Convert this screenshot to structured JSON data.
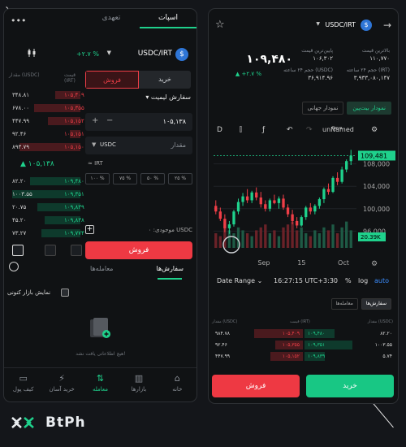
{
  "left": {
    "tabs": [
      "تعهدی",
      "اسپات"
    ],
    "active_tab": "اسپات",
    "pair": "USDC/IRT",
    "coin_glyph": "$",
    "change": "+۲.۷ %",
    "orderbook_headers": {
      "price": "قیمت (IRT)",
      "amount": "مقدار (USDC)"
    },
    "asks": [
      {
        "price": "۱۰۵,۴۰۹",
        "amount": "۳۴۸.۸۱",
        "depth": 0.35
      },
      {
        "price": "۱۰۵,۳۵۵",
        "amount": "۶۷۸.۰۰",
        "depth": 0.65
      },
      {
        "price": "۱۰۵,۱۵۲",
        "amount": "۴۴۷.۹۹",
        "depth": 0.45
      },
      {
        "price": "۱۰۵,۱۵۱",
        "amount": "۹۲.۴۶",
        "depth": 0.15
      },
      {
        "price": "۱۰۵,۱۵۰",
        "amount": "۸۹۳.۷۹",
        "depth": 0.85
      }
    ],
    "mid_price": "۱۰۵,۱۳۸",
    "bids": [
      {
        "price": "۱۰۹,۴۸۰",
        "amount": "۸۲.۲۰",
        "depth": 0.7
      },
      {
        "price": "۱۰۹,۳۵۱",
        "amount": "۱۰۰۳.۵۵",
        "depth": 0.95
      },
      {
        "price": "۱۰۹,۸۳۹",
        "amount": "۲۰.۷۵",
        "depth": 0.6
      },
      {
        "price": "۱۰۹,۸۳۸",
        "amount": "۴۵.۲۰",
        "depth": 0.5
      },
      {
        "price": "۱۰۹,۷۷۴",
        "amount": "۷۳.۲۷",
        "depth": 0.55
      }
    ],
    "buy_label": "خرید",
    "sell_label": "فروش",
    "order_type": "سفارش لیمیت",
    "price_value": "۱۰۵,۱۳۸",
    "amount_placeholder": "مقدار",
    "amount_unit": "USDC",
    "irt_label": "IRT",
    "percents": [
      "۱۰۰ %",
      "۷۵ %",
      "۵۰ %",
      "۲۵ %"
    ],
    "balance_text": "موجودی: ۰ USDC",
    "sell_button": "فروش",
    "orders_tab": "سفارش‌ها",
    "trades_tab": "معامله‌ها",
    "show_market": "نمایش بازار کنونی",
    "empty_text": "هیچ اطلاعاتی یافت نشد!",
    "nav": [
      {
        "label": "خانه",
        "icon": "⌂"
      },
      {
        "label": "بازارها",
        "icon": "▥"
      },
      {
        "label": "معامله",
        "icon": "⇅"
      },
      {
        "label": "خرید آسان",
        "icon": "⚡"
      },
      {
        "label": "کیف پول",
        "icon": "▭"
      }
    ]
  },
  "right": {
    "pair": "USDC/IRT",
    "coin_glyph": "$",
    "price": "۱۰۹,۴۸۰",
    "change": "+۲.۷ %",
    "stats": {
      "high_label": "بالاترین قیمت",
      "high": "۱۱۰,۷۷۰",
      "low_label": "پایین‌ترین قیمت",
      "low": "۱۰۶,۳۰۲",
      "vol_irt_label": "حجم ۲۴ ساعته (IRT)",
      "vol_irt": "۳,۹۳۳,۰۸۰,۱۴۷",
      "vol_usdc_label": "حجم ۲۴ ساعته (USDC)",
      "vol_usdc": "۳۶,۹۱۴.۹۶"
    },
    "chart_tabs": [
      "نمودار جهانی",
      "نمودار بیت‌پین"
    ],
    "active_chart_tab": "نمودار بیت‌پین",
    "toolbar": {
      "interval": "D",
      "title": "unNamed",
      "save": "Save"
    },
    "range": {
      "label": "Date Range",
      "time": "16:27:15 UTC+3:30",
      "pct": "%",
      "log": "log",
      "auto": "auto"
    },
    "order_tabs": [
      "معامله‌ها",
      "سفارش‌ها"
    ],
    "orderbook_headers": {
      "amount": "مقدار (USDC)",
      "price": "قیمت (IRT)",
      "amount2": "مقدار (USDC)"
    },
    "bids": [
      {
        "price": "۱۰۹,۴۸۰",
        "amount": "۸۲.۲۰",
        "depth": 0.6
      },
      {
        "price": "۱۰۹,۳۵۱",
        "amount": "۱۰۰۳.۵۵",
        "depth": 0.95
      },
      {
        "price": "۱۰۹,۸۳۹",
        "amount": "۵.۷۴",
        "depth": 0.4
      }
    ],
    "asks": [
      {
        "price": "۱۰۵,۴۰۹",
        "amount": "۹۸۴.۷۸",
        "depth": 0.9
      },
      {
        "price": "۱۰۵,۳۵۵",
        "amount": "۹۲.۴۶",
        "depth": 0.5
      },
      {
        "price": "۱۰۵,۱۵۲",
        "amount": "۴۴۷.۹۹",
        "depth": 0.6
      }
    ],
    "sell_button": "فروش",
    "buy_button": "خرید"
  },
  "chart_data": {
    "type": "candlestick",
    "x_ticks": [
      "Sep",
      "15",
      "Oct"
    ],
    "y_ticks": [
      96000,
      100000,
      104000,
      108000
    ],
    "ylim": [
      93000,
      111000
    ],
    "price_tag": "109,481",
    "volume_tag": "20.39K",
    "candles": [
      [
        100500,
        101500,
        99000,
        99500
      ],
      [
        99500,
        100200,
        97800,
        98200
      ],
      [
        98200,
        99000,
        95800,
        96500
      ],
      [
        96500,
        97800,
        95500,
        97200
      ],
      [
        97200,
        99800,
        96800,
        99500
      ],
      [
        99500,
        101800,
        99000,
        101200
      ],
      [
        101200,
        102800,
        100500,
        102200
      ],
      [
        102200,
        103500,
        101000,
        101500
      ],
      [
        101500,
        103200,
        101000,
        102900
      ],
      [
        102900,
        103800,
        101500,
        102000
      ],
      [
        102000,
        103000,
        100200,
        100800
      ],
      [
        100800,
        101500,
        99500,
        100000
      ],
      [
        100000,
        101800,
        99500,
        101500
      ],
      [
        101500,
        102500,
        100800,
        101000
      ],
      [
        101000,
        102200,
        100000,
        101800
      ],
      [
        101800,
        102500,
        99800,
        100200
      ],
      [
        100200,
        100800,
        98500,
        99000
      ],
      [
        99000,
        99800,
        97200,
        97800
      ],
      [
        97800,
        98500,
        96500,
        97000
      ],
      [
        97000,
        98800,
        96800,
        98500
      ],
      [
        98500,
        100500,
        98000,
        100200
      ],
      [
        100200,
        101000,
        99000,
        99500
      ],
      [
        99500,
        100800,
        99000,
        100500
      ],
      [
        100500,
        102000,
        100000,
        101700
      ],
      [
        101700,
        103800,
        101000,
        103500
      ],
      [
        103500,
        104500,
        102500,
        103000
      ],
      [
        103000,
        105800,
        102800,
        105500
      ],
      [
        105500,
        106500,
        104200,
        104800
      ],
      [
        104800,
        107500,
        104500,
        107000
      ],
      [
        107000,
        108800,
        106500,
        108500
      ],
      [
        108500,
        110500,
        107800,
        109481
      ]
    ],
    "volumes": [
      0.5,
      0.4,
      0.9,
      0.6,
      0.5,
      0.7,
      0.6,
      0.5,
      0.4,
      0.6,
      0.7,
      0.8,
      0.5,
      0.6,
      0.4,
      0.7,
      0.8,
      0.9,
      0.6,
      0.7,
      0.5,
      0.4,
      0.6,
      0.5,
      0.7,
      0.6,
      0.8,
      0.5,
      0.7,
      0.9,
      0.6
    ]
  }
}
